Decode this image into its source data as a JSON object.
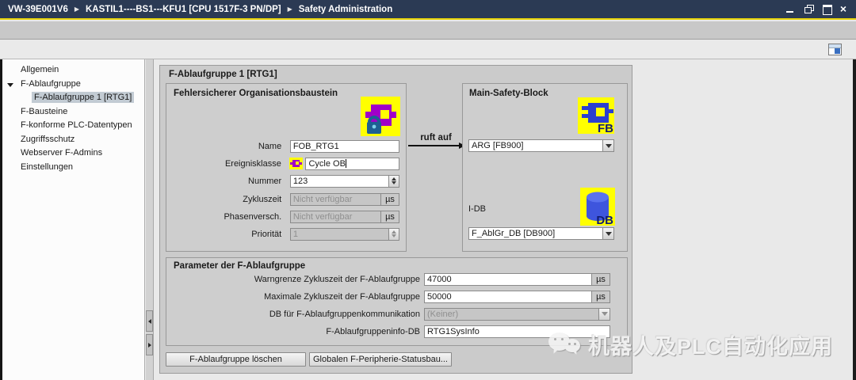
{
  "title_bar": {
    "breadcrumb": [
      {
        "label": "VW-39E001V6"
      },
      {
        "label": "KASTIL1----BS1---KFU1 [CPU 1517F-3 PN/DP]"
      },
      {
        "label": "Safety Administration"
      }
    ]
  },
  "sidebar": {
    "items": [
      {
        "label": "Allgemein"
      },
      {
        "label": "F-Ablaufgruppe"
      },
      {
        "label": "F-Ablaufgruppe 1 [RTG1]"
      },
      {
        "label": "F-Bausteine"
      },
      {
        "label": "F-konforme PLC-Datentypen"
      },
      {
        "label": "Zugriffsschutz"
      },
      {
        "label": "Webserver F-Admins"
      },
      {
        "label": "Einstellungen"
      }
    ]
  },
  "main": {
    "panel_title": "F-Ablaufgruppe 1 [RTG1]",
    "ruft_auf": "ruft auf",
    "fob": {
      "title": "Fehlersicherer Organisationsbaustein",
      "fields": {
        "name": {
          "label": "Name",
          "value": "FOB_RTG1"
        },
        "ereignisklasse": {
          "label": "Ereignisklasse",
          "value": "Cycle OB"
        },
        "nummer": {
          "label": "Nummer",
          "value": "123"
        },
        "zykluszeit": {
          "label": "Zykluszeit",
          "value": "Nicht verfügbar",
          "unit": "µs"
        },
        "phasenversch": {
          "label": "Phasenversch.",
          "value": "Nicht verfügbar",
          "unit": "µs"
        },
        "prioritaet": {
          "label": "Priorität",
          "value": "1"
        }
      }
    },
    "msb": {
      "title": "Main-Safety-Block",
      "fb_value": "ARG [FB900]",
      "fb_badge": "FB",
      "idb_label": "I-DB",
      "idb_value": "F_AblGr_DB [DB900]",
      "db_badge": "DB"
    },
    "param": {
      "title": "Parameter der F-Ablaufgruppe",
      "rows": [
        {
          "label": "Warngrenze Zykluszeit der F-Ablaufgruppe",
          "value": "47000",
          "unit": "µs"
        },
        {
          "label": "Maximale Zykluszeit der F-Ablaufgruppe",
          "value": "50000",
          "unit": "µs"
        },
        {
          "label": "DB für F-Ablaufgruppenkommunikation",
          "value": "(Keiner)"
        },
        {
          "label": "F-Ablaufgruppeninfo-DB",
          "value": "RTG1SysInfo"
        }
      ]
    },
    "buttons": [
      {
        "label": "F-Ablaufgruppe löschen"
      },
      {
        "label": "Globalen F-Peripherie-Statusbau..."
      }
    ]
  },
  "watermark": {
    "text": "机器人及PLC自动化应用"
  },
  "colors": {
    "titlebar": "#2b3a54",
    "accent_yellow": "#e8d40a",
    "selection": "#c2cbd3",
    "icon_yellow": "#ffff00",
    "icon_purple": "#a000c8",
    "icon_blue": "#2b3fd0",
    "db_blue": "#4a5fe0",
    "disabled_text": "#8f8f8f"
  }
}
